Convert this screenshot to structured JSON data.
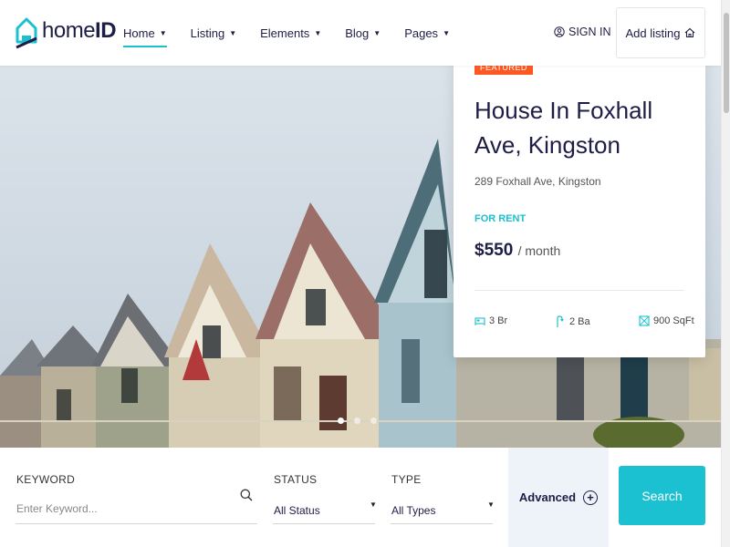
{
  "header": {
    "logo_prefix": "home",
    "logo_suffix": "ID",
    "nav": [
      {
        "label": "Home",
        "active": true
      },
      {
        "label": "Listing"
      },
      {
        "label": "Elements"
      },
      {
        "label": "Blog"
      },
      {
        "label": "Pages"
      }
    ],
    "sign_in": "SIGN IN",
    "add_listing": "Add listing"
  },
  "featured": {
    "badge": "FEATURED",
    "title": "House In Foxhall Ave, Kingston",
    "address": "289 Foxhall Ave, Kingston",
    "status": "FOR RENT",
    "price": "$550",
    "period": "/ month",
    "beds": "3 Br",
    "baths": "2 Ba",
    "area": "900 SqFt"
  },
  "search": {
    "keyword_label": "KEYWORD",
    "keyword_placeholder": "Enter Keyword...",
    "status_label": "STATUS",
    "status_value": "All Status",
    "type_label": "TYPE",
    "type_value": "All Types",
    "advanced": "Advanced",
    "button": "Search"
  },
  "colors": {
    "accent": "#1bc0d1",
    "navy": "#1e1d45",
    "badge": "#ff5722"
  }
}
